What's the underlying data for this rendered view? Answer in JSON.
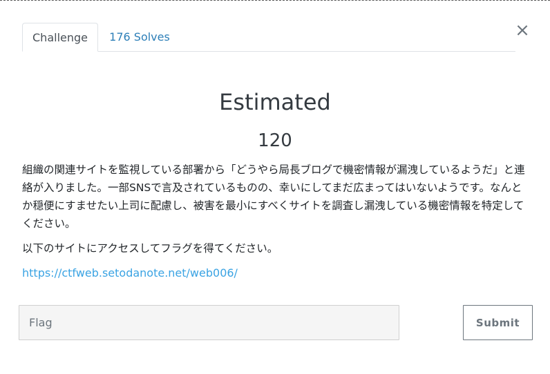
{
  "tabs": [
    {
      "label": "Challenge",
      "active": true
    },
    {
      "label": "176 Solves",
      "active": false
    }
  ],
  "close_symbol": "×",
  "challenge": {
    "name": "Estimated",
    "value": "120",
    "description": [
      "組織の関連サイトを監視している部署から「どうやら局長ブログで機密情報が漏洩しているようだ」と連絡が入りました。一部SNSで言及されているものの、幸いにしてまだ広まってはいないようです。なんとか穏便にすませたい上司に配慮し、被害を最小にすべくサイトを調査し漏洩している機密情報を特定してください。",
      "以下のサイトにアクセスしてフラグを得てください。"
    ],
    "link": "https://ctfweb.setodanote.net/web006/"
  },
  "form": {
    "placeholder": "Flag",
    "submit_label": "Submit"
  },
  "colors": {
    "link": "#3aa3e3",
    "tab_link": "#2d7fb8",
    "input_bg": "#f5f5f5"
  }
}
